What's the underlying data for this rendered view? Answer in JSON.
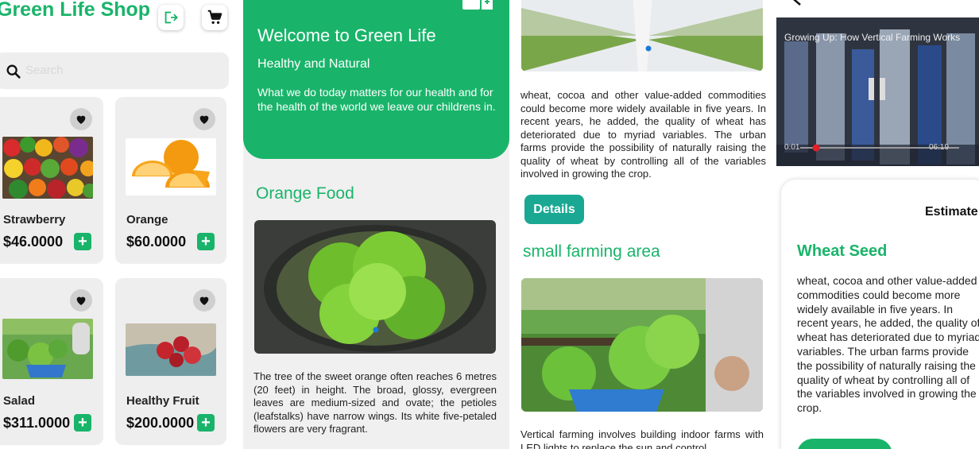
{
  "shop": {
    "title": "Green Life Shop",
    "search_placeholder": "Search",
    "products": [
      {
        "name": "Strawberry",
        "price": "$46.0000"
      },
      {
        "name": "Orange",
        "price": "$60.0000"
      },
      {
        "name": "Salad",
        "price": "$311.0000"
      },
      {
        "name": "Healthy Fruit",
        "price": "$200.0000"
      }
    ],
    "plus_label": "+"
  },
  "home": {
    "hero_title": "Welcome to Green Life",
    "hero_subtitle": "Healthy and Natural",
    "hero_text": "What we do today matters for our health and for the health of the world we leave our childrens in.",
    "section_title": "Orange Food",
    "section_text": "The tree of the sweet orange often reaches 6 metres (20 feet) in height. The broad, glossy, evergreen leaves are medium-sized and ovate; the petioles (leafstalks) have narrow wings. Its white five-petaled flowers are very fragrant."
  },
  "article": {
    "top_text": "wheat, cocoa and other value-added commodities could become more widely available in five years. In recent years, he added, the quality of wheat has deteriorated due to myriad variables. The urban farms provide the possibility of naturally raising the quality of wheat by controlling all of the variables involved in growing the crop.",
    "details_label": "Details",
    "section_title": "small farming area",
    "bottom_text": "Vertical farming involves building indoor farms with LED lights to replace the sun and control"
  },
  "video": {
    "title": "Growing Up: How Vertical Farming Works",
    "current_time": "0:01",
    "duration": "06:19",
    "sheet_heading": "Estimate",
    "product_title": "Wheat Seed",
    "product_text": "wheat, cocoa and other value-added commodities could become more widely available in five years. In recent years, he added, the quality of wheat has deteriorated due to myriad variables. The urban farms provide the possibility of naturally raising the quality of wheat by controlling all of the variables involved in growing the crop."
  },
  "colors": {
    "brand_green": "#19b46a",
    "details_teal": "#1aa893"
  }
}
